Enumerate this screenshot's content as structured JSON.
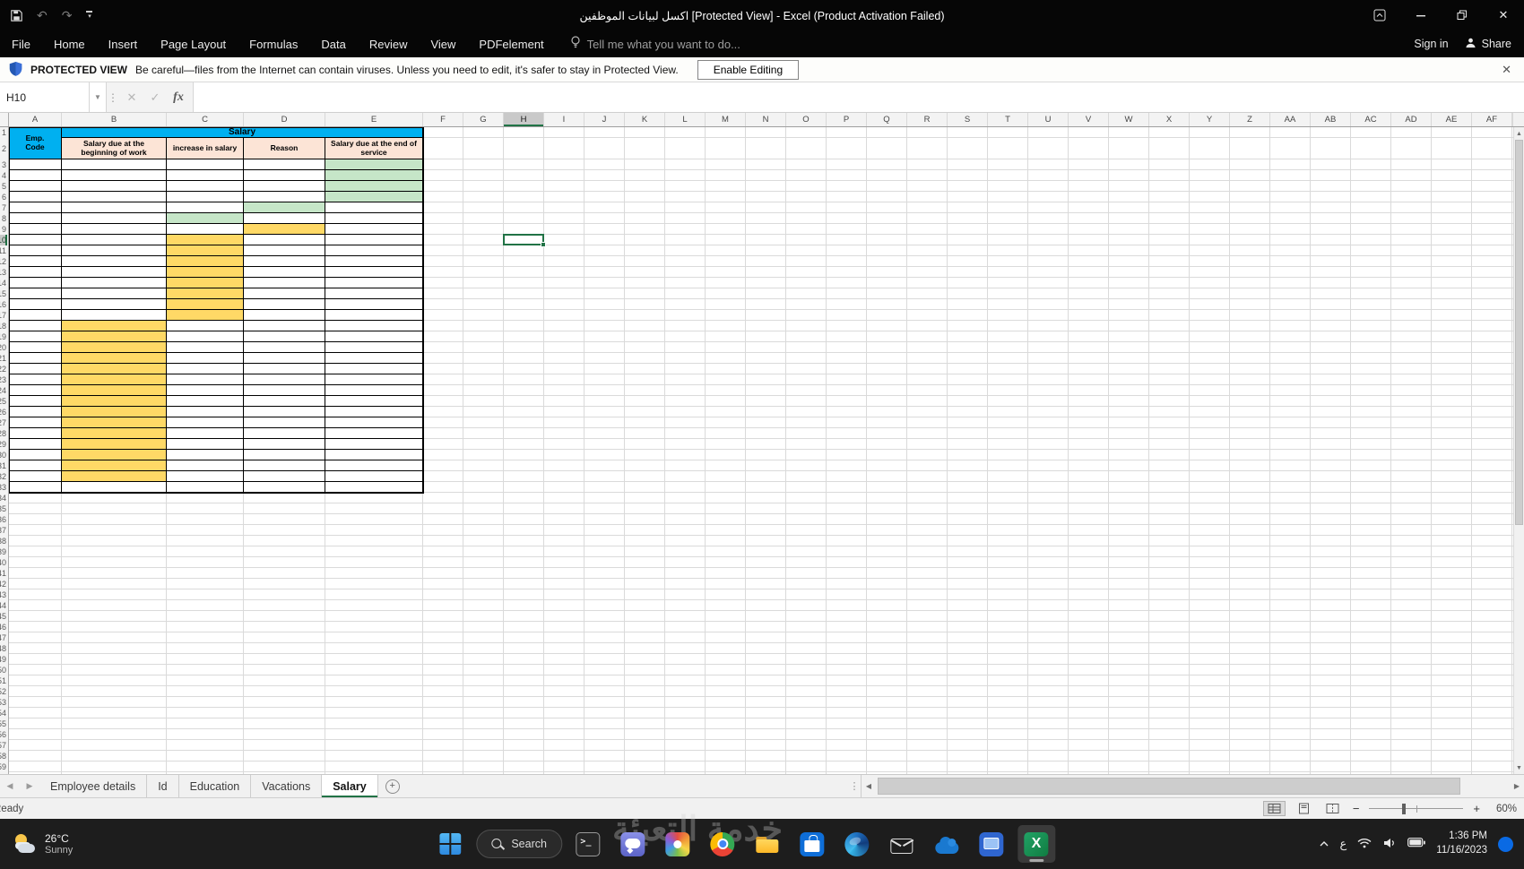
{
  "titlebar": {
    "title": "اكسل لبيانات الموظفين  [Protected View] - Excel (Product Activation Failed)"
  },
  "ribbon": {
    "tabs": [
      "File",
      "Home",
      "Insert",
      "Page Layout",
      "Formulas",
      "Data",
      "Review",
      "View",
      "PDFelement"
    ],
    "tell_me": "Tell me what you want to do...",
    "sign_in": "Sign in",
    "share": "Share"
  },
  "protected_view": {
    "label": "PROTECTED VIEW",
    "message": "Be careful—files from the Internet can contain viruses. Unless you need to edit, it's safer to stay in Protected View.",
    "button": "Enable Editing"
  },
  "formula_bar": {
    "name_box": "H10",
    "formula": ""
  },
  "sheet": {
    "columns": [
      "A",
      "B",
      "C",
      "D",
      "E",
      "F",
      "G",
      "H",
      "I",
      "J",
      "K",
      "L",
      "M",
      "N",
      "O",
      "P",
      "Q",
      "R",
      "S",
      "T",
      "U",
      "V",
      "W",
      "X",
      "Y",
      "Z",
      "AA",
      "AB",
      "AC",
      "AD",
      "AE",
      "AF"
    ],
    "row_count": 60,
    "selected_cell": {
      "col": "H",
      "row": 10
    },
    "table": {
      "title": "Salary",
      "corner_header": "Emp. Code",
      "headers": [
        "Salary due at the beginning of work",
        "increase in salary",
        "Reason",
        "Salary due at the end of service"
      ],
      "first_data_row": 3,
      "last_data_row": 33,
      "colors": {
        "banner": "#00b0f0",
        "header": "#fce4d6",
        "green": "#c6e6c8",
        "yellow": "#ffd966"
      },
      "fills": [
        {
          "col": "E",
          "from": 3,
          "to": 6,
          "fill": "green"
        },
        {
          "col": "D",
          "from": 7,
          "to": 7,
          "fill": "green"
        },
        {
          "col": "C",
          "from": 8,
          "to": 8,
          "fill": "green"
        },
        {
          "col": "D",
          "from": 9,
          "to": 9,
          "fill": "yellow"
        },
        {
          "col": "C",
          "from": 10,
          "to": 17,
          "fill": "yellow"
        },
        {
          "col": "B",
          "from": 18,
          "to": 32,
          "fill": "yellow"
        }
      ]
    }
  },
  "sheet_tabs": {
    "tabs": [
      {
        "label": "Employee details",
        "active": false
      },
      {
        "label": "Id",
        "active": false
      },
      {
        "label": "Education",
        "active": false
      },
      {
        "label": "Vacations",
        "active": false
      },
      {
        "label": "Salary",
        "active": true
      }
    ]
  },
  "status_bar": {
    "status": "Ready",
    "zoom": "60%"
  },
  "taskbar": {
    "weather": {
      "temp": "26°C",
      "condition": "Sunny"
    },
    "search_label": "Search",
    "apps": [
      "terminal",
      "chat",
      "photos",
      "chrome",
      "file-explorer",
      "store",
      "edge",
      "mail",
      "onedrive",
      "media",
      "excel"
    ],
    "active_app": "excel",
    "tray": {
      "language": "ع",
      "time": "1:36 PM",
      "date": "11/16/2023"
    }
  },
  "watermark": {
    "text": "خدمة التعبئة"
  }
}
